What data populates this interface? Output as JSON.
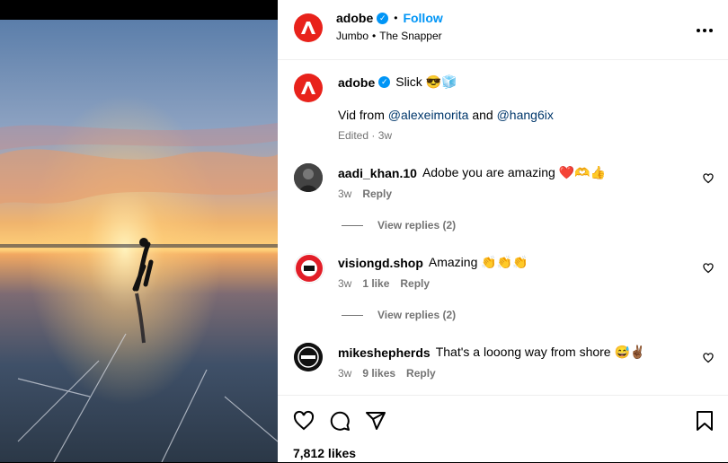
{
  "post": {
    "username": "adobe",
    "follow_label": "Follow",
    "dot": "•",
    "audio": "Jumbo",
    "audio_sep": "•",
    "audio_artist": "The Snapper",
    "more_icon": "more-horizontal-icon"
  },
  "caption": {
    "username": "adobe",
    "text": "Slick 😎🧊",
    "line2_prefix": "Vid from",
    "mention1": "@alexeimorita",
    "and": "and",
    "mention2": "@hang6ix",
    "meta": "Edited · 3w"
  },
  "comments": [
    {
      "username": "aadi_khan.10",
      "text": "Adobe you are amazing ❤️🫶👍",
      "time": "3w",
      "likes": "",
      "reply_label": "Reply",
      "view_replies": "View replies (2)"
    },
    {
      "username": "visiongd.shop",
      "text": "Amazing 👏👏👏",
      "time": "3w",
      "likes": "1 like",
      "reply_label": "Reply",
      "view_replies": "View replies (2)"
    },
    {
      "username": "mikeshepherds",
      "text": "That's a looong way from shore 😅✌🏾",
      "time": "3w",
      "likes": "9 likes",
      "reply_label": "Reply"
    }
  ],
  "footer": {
    "likes": "7,812 likes"
  },
  "colors": {
    "accent": "#0095f6",
    "adobe_red": "#e8221b",
    "muted": "#737373"
  }
}
